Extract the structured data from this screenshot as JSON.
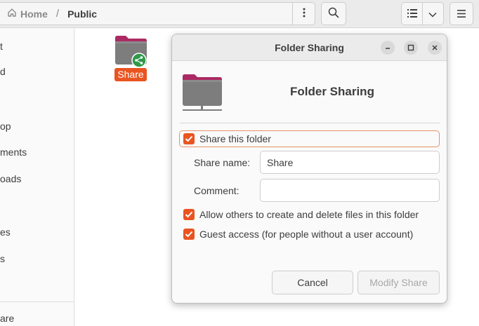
{
  "header": {
    "path_home": "Home",
    "path_separator": "/",
    "path_current": "Public"
  },
  "sidebar": {
    "items": [
      {
        "label": "t"
      },
      {
        "label": "d"
      },
      {
        "label": "op"
      },
      {
        "label": "ments"
      },
      {
        "label": "oads"
      },
      {
        "label": "es"
      },
      {
        "label": "s"
      },
      {
        "label": "are"
      }
    ]
  },
  "content": {
    "folder_name": "Share"
  },
  "dialog": {
    "window_title": "Folder Sharing",
    "heading": "Folder Sharing",
    "share_folder_label": "Share this folder",
    "share_folder_checked": true,
    "share_name_label": "Share name:",
    "share_name_value": "Share",
    "comment_label": "Comment:",
    "comment_value": "",
    "allow_others_label": "Allow others to create and delete files in this folder",
    "allow_others_checked": true,
    "guest_access_label": "Guest access (for people without a user account)",
    "guest_access_checked": true,
    "cancel_label": "Cancel",
    "modify_label": "Modify Share"
  },
  "colors": {
    "accent": "#e95420",
    "folder_top": "#ab2a63",
    "folder_body": "#7d7d7d",
    "share_badge": "#2e9a4a"
  }
}
